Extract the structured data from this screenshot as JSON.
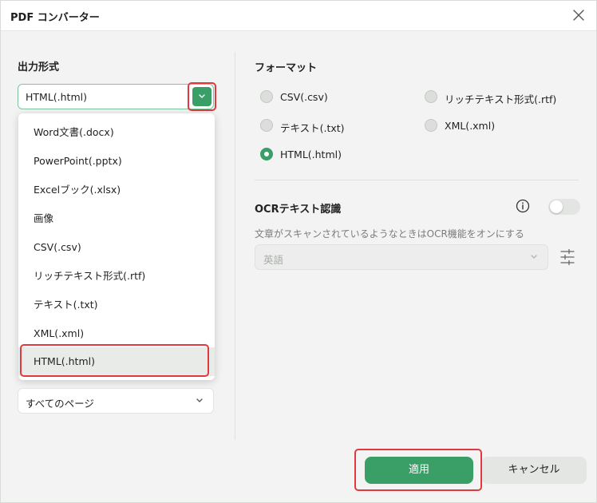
{
  "window": {
    "title": "PDF コンバーター"
  },
  "left": {
    "output_label": "出力形式",
    "selected_format": "HTML(.html)",
    "dropdown_items": [
      "Word文書(.docx)",
      "PowerPoint(.pptx)",
      "Excelブック(.xlsx)",
      "画像",
      "CSV(.csv)",
      "リッチテキスト形式(.rtf)",
      "テキスト(.txt)",
      "XML(.xml)",
      "HTML(.html)"
    ],
    "pages_value": "すべてのページ"
  },
  "right": {
    "format_label": "フォーマット",
    "formats": [
      {
        "label": "CSV(.csv)",
        "selected": false
      },
      {
        "label": "リッチテキスト形式(.rtf)",
        "selected": false
      },
      {
        "label": "テキスト(.txt)",
        "selected": false
      },
      {
        "label": "XML(.xml)",
        "selected": false
      },
      {
        "label": "HTML(.html)",
        "selected": true
      }
    ],
    "ocr_label": "OCRテキスト認識",
    "ocr_enabled": false,
    "ocr_description": "文章がスキャンされているようなときはOCR機能をオンにする",
    "ocr_language": "英語"
  },
  "buttons": {
    "apply": "適用",
    "cancel": "キャンセル"
  },
  "colors": {
    "accent": "#3a9e67",
    "highlight": "#e0393e"
  },
  "icons": [
    "close-icon",
    "chevron-down-icon",
    "info-icon",
    "settings-sliders-icon"
  ]
}
